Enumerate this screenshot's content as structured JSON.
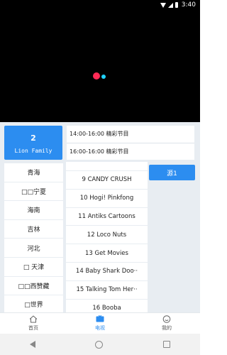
{
  "status_bar": {
    "time": "3:40"
  },
  "channel": {
    "number": "2",
    "name": "Lion Family"
  },
  "epg": [
    {
      "time": "14:00-16:00",
      "title": "精彩节目"
    },
    {
      "time": "16:00-16:00",
      "title": "精彩节目"
    }
  ],
  "provinces": [
    "青海",
    "□□宁夏",
    "海南",
    "吉林",
    "河北",
    "□ 天津",
    "□□西赞藏",
    "□世界"
  ],
  "programs": [
    "",
    "9 CANDY CRUSH",
    "10 Hogi! Pinkfong",
    "11 Antiks Cartoons",
    "12 Loco Nuts",
    "13 Get Movies",
    "14 Baby Shark Doo··",
    "15 Talking Tom Her··",
    "16 Booba"
  ],
  "source_button": "源1",
  "tabs": [
    {
      "label": "首页"
    },
    {
      "label": "电视"
    },
    {
      "label": "我的"
    }
  ],
  "colors": {
    "accent": "#2c8df0",
    "panel_bg": "#e8edf2",
    "logo_red": "#ff2a55",
    "logo_cyan": "#1fd3ff"
  }
}
